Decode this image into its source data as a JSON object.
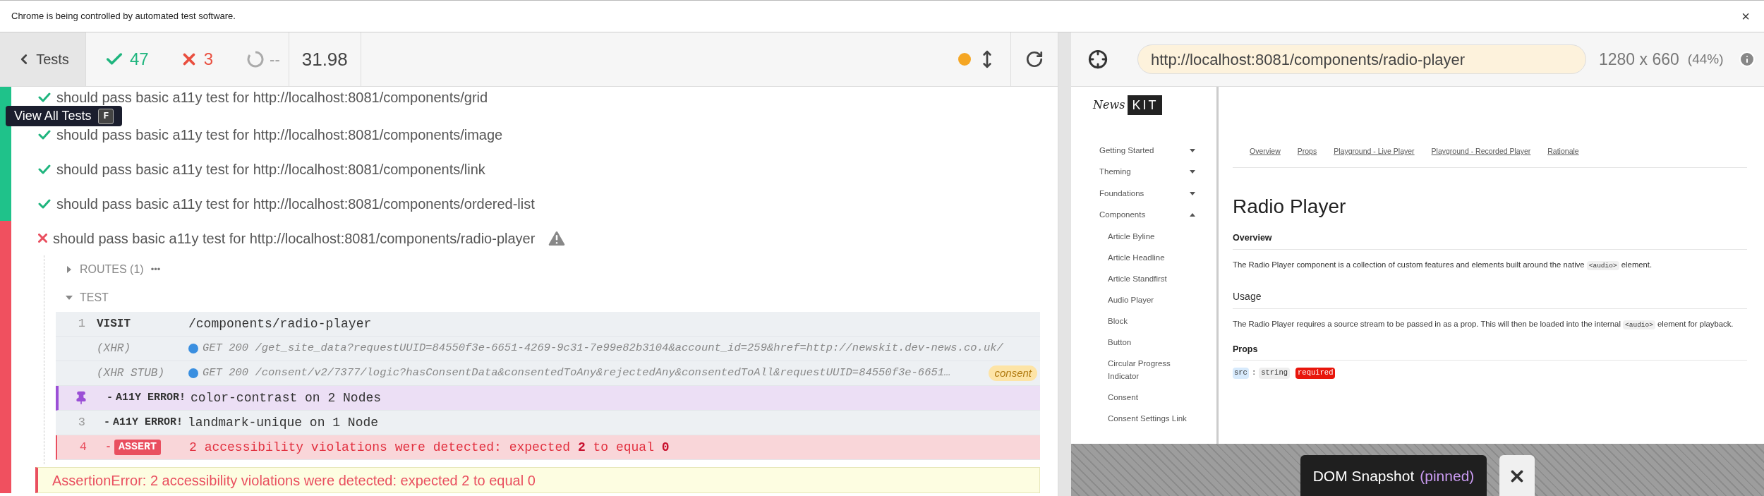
{
  "banner": {
    "text": "Chrome is being controlled by automated test software.",
    "close": "×"
  },
  "header": {
    "back": "Tests",
    "passed": "47",
    "failed": "3",
    "pending": "--",
    "duration": "31.98"
  },
  "tooltip": {
    "text": "View All Tests",
    "key": "F"
  },
  "tests": [
    {
      "title": "should pass basic a11y test for http://localhost:8081/components/grid",
      "kind": "passed",
      "warning": false
    },
    {
      "title": "should pass basic a11y test for http://localhost:8081/components/image",
      "kind": "passed",
      "warning": false
    },
    {
      "title": "should pass basic a11y test for http://localhost:8081/components/link",
      "kind": "passed",
      "warning": false
    },
    {
      "title": "should pass basic a11y test for http://localhost:8081/components/ordered-list",
      "kind": "passed",
      "warning": false
    },
    {
      "title": "should pass basic a11y test for http://localhost:8081/components/radio-player",
      "kind": "failed",
      "warning": true,
      "routes": {
        "label": "ROUTES (1)",
        "more": "•••",
        "expanded": false
      },
      "test": {
        "label": "TEST",
        "expanded": true
      },
      "commands": [
        {
          "kind": "visit",
          "pinned": false,
          "number": "1",
          "name": "VISIT",
          "message": "/components/radio-player"
        },
        {
          "kind": "xhr",
          "pinned": false,
          "name": "(XHR)",
          "message": "GET 200 /get_site_data?requestUUID=84550f3e-6651-4269-9c31-7e99e82b3104&account_id=259&href=http://newskit.dev-news.co.uk/"
        },
        {
          "kind": "xhr",
          "pinned": false,
          "name": "(XHR STUB)",
          "message": "GET 200 /consent/v2/7377/logic?hasConsentData&consentedToAny&rejectedAny&consentedToAll&requestUUID=84550f3e-6651…",
          "alias": "consent"
        },
        {
          "kind": "error",
          "pinned": true,
          "prefix": "-",
          "name": "A11Y ERROR!",
          "message": "color-contrast on 2 Nodes"
        },
        {
          "kind": "error",
          "pinned": false,
          "number": "3",
          "prefix": "-",
          "name": "A11Y ERROR!",
          "message": "landmark-unique on 1 Node"
        },
        {
          "kind": "assert",
          "pinned": false,
          "number": "4",
          "prefix": "-",
          "name": "ASSERT",
          "message": "2 accessibility violations were detected: expected **2** to equal **0**"
        }
      ],
      "error": "AssertionError: 2 accessibility violations were detected: expected 2 to equal 0"
    }
  ],
  "aut": {
    "url": "http://localhost:8081/components/radio-player",
    "viewport": "1280 x 660",
    "scale": "(44%)",
    "page": {
      "logo": {
        "script": "News",
        "block": "KIT"
      },
      "nav": [
        {
          "label": "Getting Started",
          "expanded": false
        },
        {
          "label": "Theming",
          "expanded": false
        },
        {
          "label": "Foundations",
          "expanded": false
        },
        {
          "label": "Components",
          "expanded": true,
          "children": [
            {
              "label": "Article Byline"
            },
            {
              "label": "Article Headline"
            },
            {
              "label": "Article Standfirst"
            },
            {
              "label": "Audio Player"
            },
            {
              "label": "Block"
            },
            {
              "label": "Button"
            },
            {
              "label": "Circular Progress Indicator"
            },
            {
              "label": "Consent"
            },
            {
              "label": "Consent Settings Link"
            }
          ]
        }
      ],
      "tabs": [
        "Overview",
        "Props",
        "Playground - Live Player",
        "Playground - Recorded Player",
        "Rationale"
      ],
      "title": "Radio Player",
      "sections": [
        {
          "kind": "heading",
          "text": "Overview"
        },
        {
          "kind": "paragraph",
          "parts": [
            {
              "text": "The Radio Player component is a collection of custom features and elements built around the native "
            },
            {
              "code": "<audio>"
            },
            {
              "text": " element."
            }
          ]
        },
        {
          "kind": "subheading",
          "text": "Usage"
        },
        {
          "kind": "paragraph",
          "parts": [
            {
              "text": "The Radio Player requires a source stream to be passed in as a prop. This will then be loaded into the internal "
            },
            {
              "code": "<audio>"
            },
            {
              "text": " element for playback."
            }
          ]
        },
        {
          "kind": "heading",
          "text": "Props"
        },
        {
          "kind": "prop",
          "name": "src",
          "separator": ":",
          "type": "string",
          "badge": "required"
        }
      ]
    },
    "snapshot": {
      "label": "DOM Snapshot",
      "state": "(pinned)"
    }
  }
}
